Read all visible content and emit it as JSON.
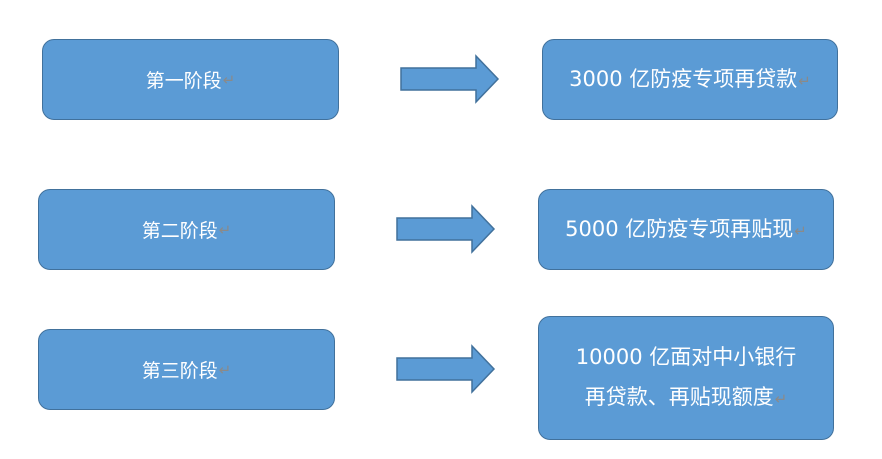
{
  "colors": {
    "box_fill": "#5b9bd5",
    "box_border": "#41719c",
    "text": "#ffffff",
    "paragraph_mark": "#8a8a8a"
  },
  "paragraph_mark": "↵",
  "rows": [
    {
      "stage": "第一阶段",
      "result_lines": [
        "3000 亿防疫专项再贷款"
      ]
    },
    {
      "stage": "第二阶段",
      "result_lines": [
        "5000 亿防疫专项再贴现"
      ]
    },
    {
      "stage": "第三阶段",
      "result_lines": [
        "10000 亿面对中小银行",
        "再贷款、再贴现额度"
      ]
    }
  ]
}
